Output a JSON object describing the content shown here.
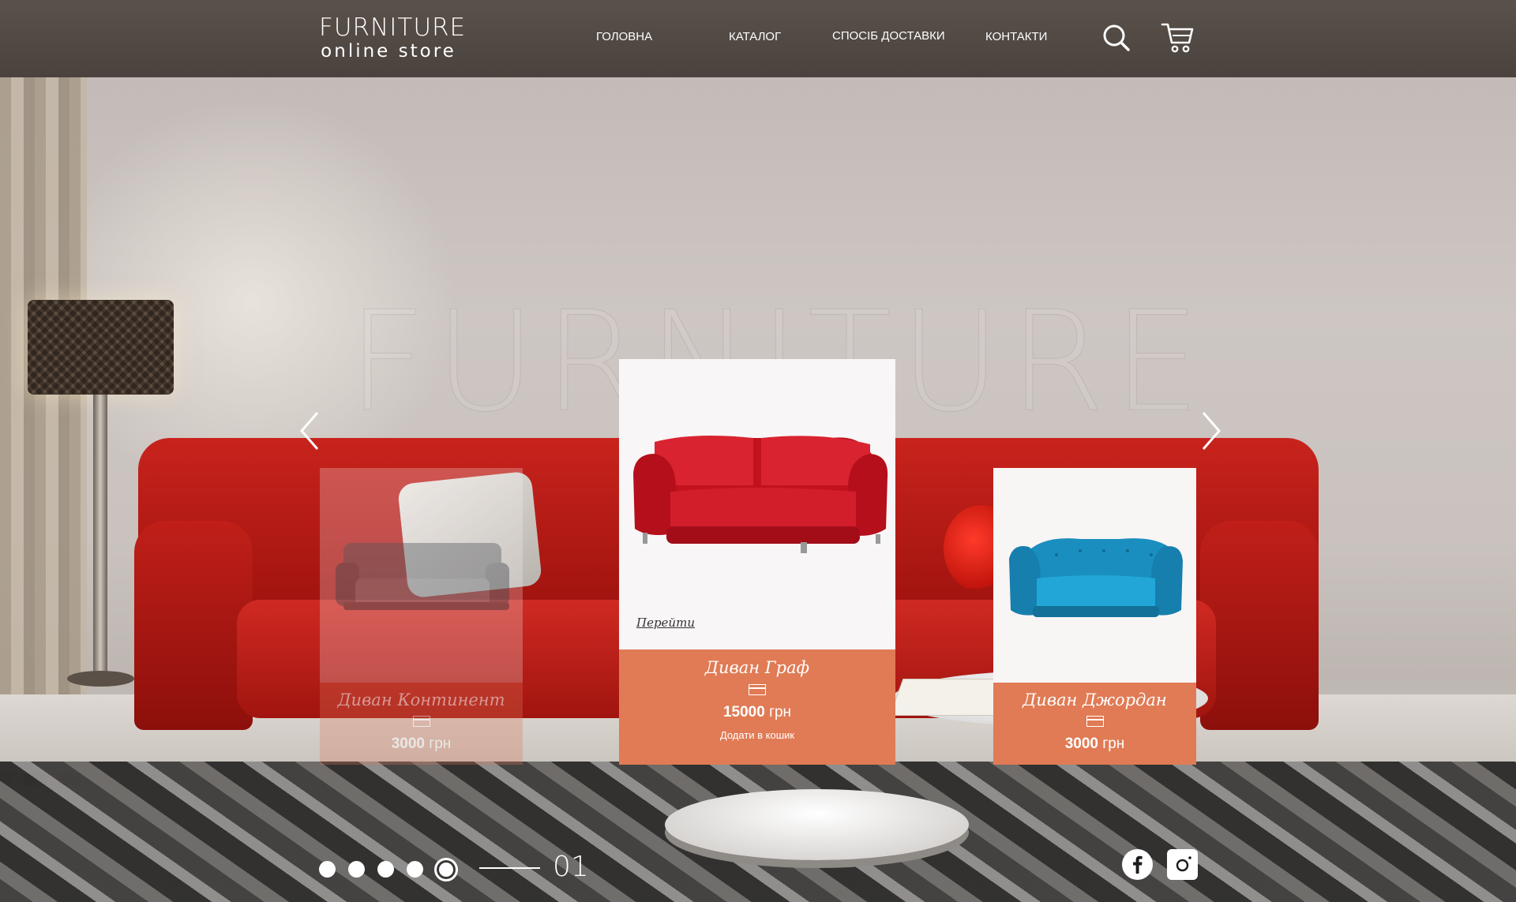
{
  "logo": {
    "line1": "FURNITURE",
    "line2": "online store"
  },
  "nav": {
    "items": [
      {
        "label": "ГОЛОВНА"
      },
      {
        "label": "КАТАЛОГ"
      },
      {
        "label": "СПОСІБ ДОСТАВКИ"
      },
      {
        "label": "КОНТАКТИ"
      }
    ]
  },
  "header_icons": [
    "search-icon",
    "cart-icon"
  ],
  "hero": {
    "watermark": "FURNITURE"
  },
  "slider": {
    "cards": [
      {
        "name": "Диван Континент",
        "price": "3000",
        "currency": "грн",
        "sofa_color": "#8a8c90"
      },
      {
        "name": "Диван Граф",
        "price": "15000",
        "currency": "грн",
        "link": "Перейти",
        "add_to_cart": "Додати в кошик",
        "sofa_color": "#d01f2a"
      },
      {
        "name": "Диван Джордан",
        "price": "3000",
        "currency": "грн",
        "sofa_color": "#1f9bc9"
      }
    ],
    "dots_count": 5,
    "active_dot": 5,
    "slide_number": "01"
  },
  "social": [
    "facebook-icon",
    "instagram-icon"
  ],
  "colors": {
    "accent": "#e07b55",
    "header_bg": "#4f4741"
  }
}
